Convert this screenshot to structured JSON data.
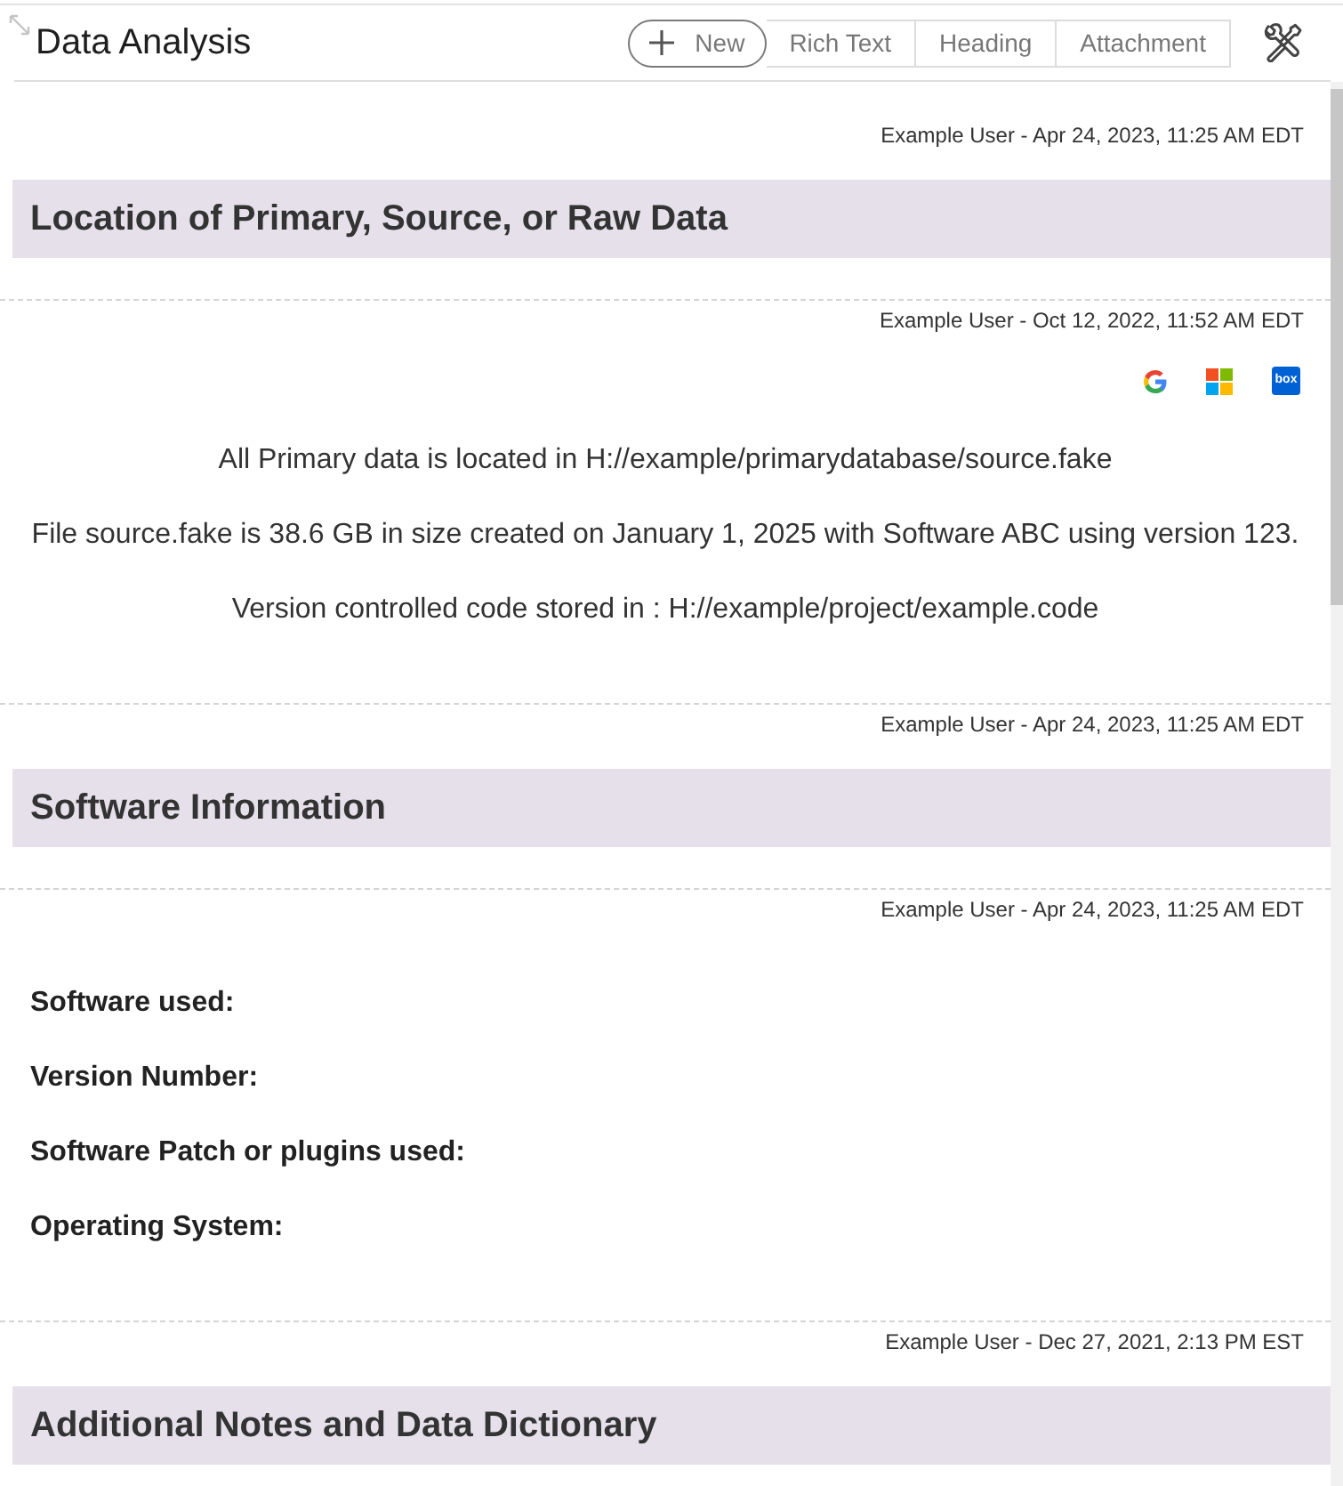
{
  "panel": {
    "title": "Data Analysis"
  },
  "toolbar": {
    "new_label": "New",
    "buttons": [
      {
        "label": "Rich Text"
      },
      {
        "label": "Heading"
      },
      {
        "label": "Attachment"
      }
    ]
  },
  "entries": [
    {
      "kind": "heading",
      "meta": "Example User - Apr 24, 2023, 11:25 AM EDT",
      "text": "Location of Primary, Source, or Raw Data"
    },
    {
      "kind": "text",
      "meta": "Example User - Oct 12, 2022, 11:52 AM EDT",
      "services": [
        {
          "kind": "g_mark"
        },
        {
          "kind": "squares"
        },
        {
          "kind": "tile",
          "label": "box"
        }
      ],
      "paragraphs": [
        "All Primary data is located in H://example/primarydatabase/source.fake",
        "File source.fake is 38.6 GB in size created on January 1, 2025 with Software ABC using version 123.",
        "Version controlled code stored in : H://example/project/example.code"
      ]
    },
    {
      "kind": "heading",
      "meta": "Example User - Apr 24, 2023, 11:25 AM EDT",
      "text": "Software Information"
    },
    {
      "kind": "fields",
      "meta": "Example User - Apr 24, 2023, 11:25 AM EDT",
      "labels": [
        "Software used:",
        "Version Number:",
        "Software Patch or plugins used:",
        "Operating System:"
      ]
    },
    {
      "kind": "heading",
      "meta": "Example User - Dec 27, 2021, 2:13 PM EST",
      "text": "Additional Notes and Data Dictionary"
    }
  ]
}
